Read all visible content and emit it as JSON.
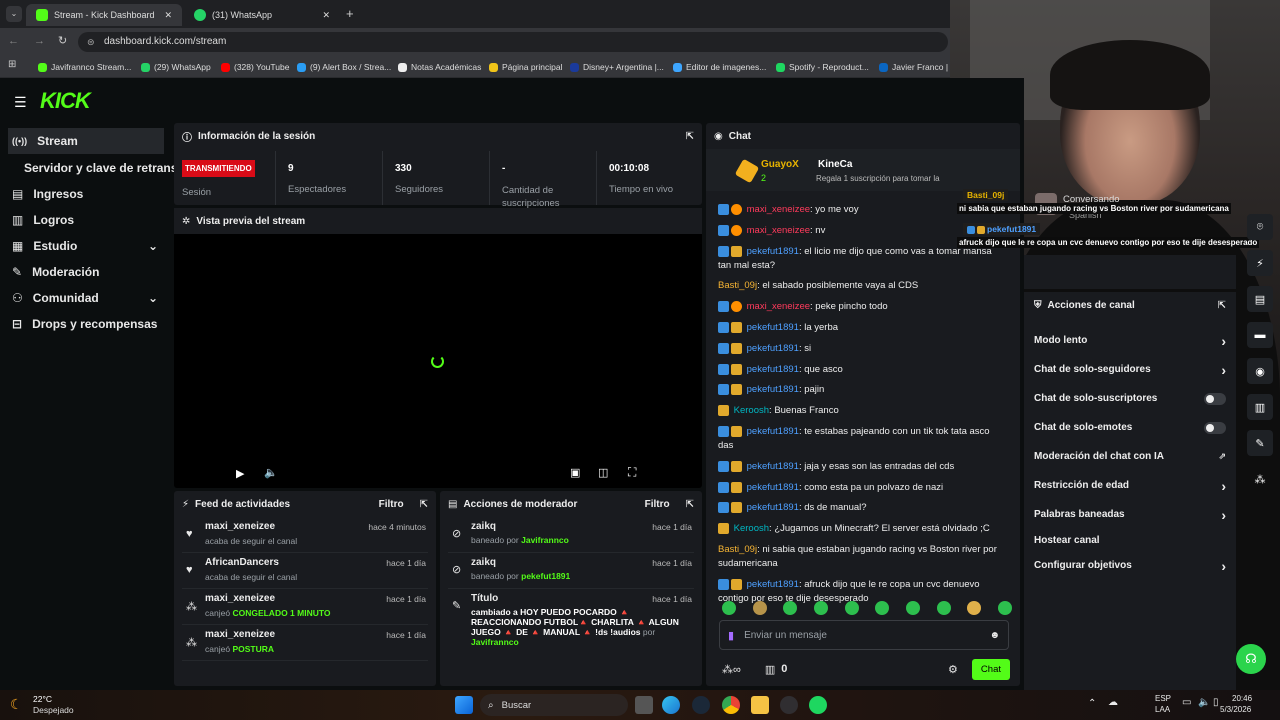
{
  "browser": {
    "tabs": [
      {
        "label": "Stream - Kick Dashboard"
      },
      {
        "label": "(31) WhatsApp"
      }
    ],
    "url": "dashboard.kick.com/stream",
    "bookmarks": [
      "Javifrannco Stream...",
      "(29) WhatsApp",
      "(328) YouTube",
      "(9) Alert Box / Strea...",
      "Notas Académicas",
      "Página principal",
      "Disney+ Argentina |...",
      "Editor de imagenes...",
      "Spotify - Reproduct...",
      "Javier Franco | Li"
    ]
  },
  "sidebar": {
    "items": [
      {
        "label": "Stream"
      },
      {
        "label": "Servidor y clave de retransm"
      },
      {
        "label": "Ingresos"
      },
      {
        "label": "Logros"
      },
      {
        "label": "Estudio"
      },
      {
        "label": "Moderación"
      },
      {
        "label": "Comunidad"
      },
      {
        "label": "Drops y recompensas"
      }
    ]
  },
  "session": {
    "title": "Información de la sesión",
    "status": "TRANSMITIENDO",
    "status_label": "Sesión",
    "stats": [
      {
        "value": "9",
        "label": "Espectadores"
      },
      {
        "value": "330",
        "label": "Seguidores"
      },
      {
        "value": "-",
        "label": "Cantidad de suscripciones"
      },
      {
        "value": "00:10:08",
        "label": "Tiempo en vivo"
      }
    ]
  },
  "preview": {
    "title": "Vista previa del stream"
  },
  "activity": {
    "title": "Feed de actividades",
    "filter": "Filtro",
    "items": [
      {
        "user": "maxi_xeneizee",
        "desc": "acaba de seguir el canal",
        "time": "hace 4 minutos"
      },
      {
        "user": "AfricanDancers",
        "desc": "acaba de seguir el canal",
        "time": "hace 1 día"
      },
      {
        "user": "maxi_xeneizee",
        "desc": "canjeó",
        "hl": "CONGELADO 1 MINUTO",
        "time": "hace 1 día"
      },
      {
        "user": "maxi_xeneizee",
        "desc": "canjeó",
        "hl": "POSTURA",
        "time": "hace 1 día"
      }
    ]
  },
  "modactions": {
    "title": "Acciones de moderador",
    "filter": "Filtro",
    "items": [
      {
        "user": "zaikq",
        "desc": "baneado por",
        "by": "Javifrannco",
        "time": "hace 1 día"
      },
      {
        "user": "zaikq",
        "desc": "baneado por",
        "by": "pekefut1891",
        "time": "hace 1 día"
      },
      {
        "user": "Título",
        "desc": "cambiado a HOY PUEDO POCARDO 🔺 REACCIONANDO FUTBOL🔺 CHARLITA 🔺 ALGUN JUEGO 🔺 DE 🔺 MANUAL 🔺 !ds !audios",
        "by": "Javifrannco",
        "pre": "por",
        "time": "hace 1 día"
      }
    ]
  },
  "chat": {
    "title": "Chat",
    "pinned_user1": "GuayoX",
    "pinned_count": "2",
    "pinned_user2": "KineCa",
    "pinned_text": "Regala 1 suscripción para tomar la",
    "messages": [
      {
        "user": "maxi_xeneizee",
        "text": "yo me voy",
        "c": "red",
        "b": "mv"
      },
      {
        "user": "maxi_xeneizee",
        "text": "nv",
        "c": "red",
        "b": "mv"
      },
      {
        "user": "pekefut1891",
        "text": "el licio me dijo que como vas a tomar mansa tan mal esta?",
        "c": "blue",
        "b": "ms"
      },
      {
        "user": "Basti_09j",
        "text": "el sabado posiblemente vaya al CDS",
        "c": "orange",
        "b": ""
      },
      {
        "user": "maxi_xeneizee",
        "text": "peke pincho todo",
        "c": "red",
        "b": "mv"
      },
      {
        "user": "pekefut1891",
        "text": "la yerba",
        "c": "blue",
        "b": "ms"
      },
      {
        "user": "pekefut1891",
        "text": "si",
        "c": "blue",
        "b": "ms"
      },
      {
        "user": "pekefut1891",
        "text": "que asco",
        "c": "blue",
        "b": "ms"
      },
      {
        "user": "pekefut1891",
        "text": "pajin",
        "c": "blue",
        "b": "ms"
      },
      {
        "user": "Keroosh",
        "text": "Buenas Franco",
        "c": "teal",
        "b": "s"
      },
      {
        "user": "pekefut1891",
        "text": "te estabas pajeando con un tik tok tata asco das",
        "c": "blue",
        "b": "ms"
      },
      {
        "user": "pekefut1891",
        "text": "jaja y esas son las entradas del cds",
        "c": "blue",
        "b": "ms"
      },
      {
        "user": "pekefut1891",
        "text": "como esta pa un polvazo de nazi",
        "c": "blue",
        "b": "ms"
      },
      {
        "user": "pekefut1891",
        "text": "ds de manual?",
        "c": "blue",
        "b": "ms"
      },
      {
        "user": "Keroosh",
        "text": "¿Jugamos un Minecraft? El server está olvidado ;C",
        "c": "teal",
        "b": "s"
      },
      {
        "user": "Basti_09j",
        "text": "ni sabia que estaban jugando racing vs Boston river por sudamericana",
        "c": "orange",
        "b": ""
      },
      {
        "user": "pekefut1891",
        "text": "afruck dijo que le re copa un cvc denuevo contigo por eso te dije desesperado",
        "c": "blue",
        "b": "ms"
      }
    ],
    "input_placeholder": "Enviar un mensaje",
    "points": "0",
    "send_label": "Chat"
  },
  "actions": {
    "title": "Acciones de canal",
    "items": [
      {
        "label": "Modo lento",
        "ctl": "arrow"
      },
      {
        "label": "Chat de solo-seguidores",
        "ctl": "arrow"
      },
      {
        "label": "Chat de solo-suscriptores",
        "ctl": "toggle"
      },
      {
        "label": "Chat de solo-emotes",
        "ctl": "toggle"
      },
      {
        "label": "Moderación del chat con IA",
        "ctl": "ext"
      },
      {
        "label": "Restricción de edad",
        "ctl": "arrow"
      },
      {
        "label": "Palabras baneadas",
        "ctl": "arrow"
      },
      {
        "label": "Hostear canal",
        "ctl": "none"
      },
      {
        "label": "Configurar objetivos",
        "ctl": "arrow"
      }
    ]
  },
  "overlay": {
    "status": "Conversando",
    "lang": "Spanish",
    "msg1_user": "Basti_09j",
    "msg1_text": "ni sabia que estaban jugando racing vs Boston river por sudamericana",
    "msg2_user": "pekefut1891",
    "msg2_text": "afruck dijo que le re copa un cvc denuevo contigo por eso te dije desesperado"
  },
  "taskbar": {
    "temp": "22°C",
    "weather": "Despejado",
    "search": "Buscar",
    "lang1": "ESP",
    "lang2": "LAA",
    "time": "20:46",
    "date": "5/3/2026"
  }
}
